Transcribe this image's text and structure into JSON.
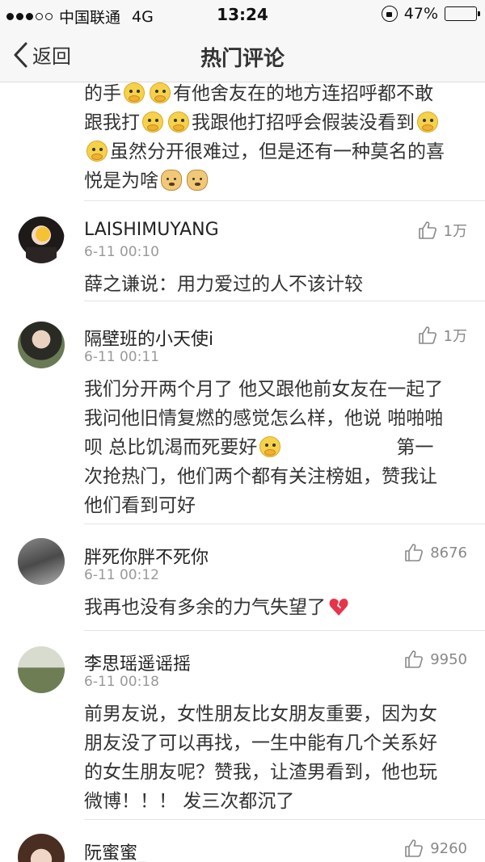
{
  "status_bar": {
    "carrier": "中国联通",
    "network": "4G",
    "time": "13:24",
    "battery": "47%",
    "battery_level": 0.47,
    "icons": [
      "signal-dots-icon",
      "rotation-lock-icon",
      "battery-icon"
    ]
  },
  "nav": {
    "back_label": "返回",
    "title": "热门评论"
  },
  "top_fragment": {
    "lines": [
      "的手",
      "有他舍友在的地方连招呼都不敢",
      "跟我打",
      "我跟他打招呼会假装没看到",
      "虽然分开很难过，但是还有一种莫名的喜",
      "悦是为啥"
    ]
  },
  "comments": [
    {
      "username": "LAISHIMUYANG",
      "time": "6-11 00:10",
      "likes": "1万",
      "lines": [
        "薛之谦说：用力爱过的人不该计较"
      ]
    },
    {
      "username": "隔壁班的小天使i",
      "time": "6-11 00:11",
      "likes": "1万",
      "lines": [
        "我们分开两个月了 他又跟他前女友在一起了",
        "我问他旧情复燃的感觉怎么样，他说 啪啪啪",
        "呗 总比饥渴而死要好",
        "第一",
        "次抢热门，他们两个都有关注榜姐，赞我让",
        "他们看到可好"
      ]
    },
    {
      "username": "胖死你胖不死你",
      "time": "6-11 00:12",
      "likes": "8676",
      "lines": [
        "我再也没有多余的力气失望了"
      ]
    },
    {
      "username": "李思瑶遥谣摇",
      "time": "6-11 00:18",
      "likes": "9950",
      "lines": [
        "前男友说，女性朋友比女朋友重要，因为女",
        "朋友没了可以再找，一生中能有几个关系好",
        "的女生朋友呢？赞我，让渣男看到，他也玩",
        "微博！！！ 发三次都沉了"
      ]
    },
    {
      "username": "阮蜜蜜_",
      "likes": "9260"
    }
  ],
  "icons": {
    "back": "chevron-left-icon",
    "like": "thumbs-up-icon",
    "emoji_face": "hand-over-mouth-emoji",
    "emoji_doge": "doge-emoji",
    "emoji_heart": "broken-heart-emoji"
  }
}
